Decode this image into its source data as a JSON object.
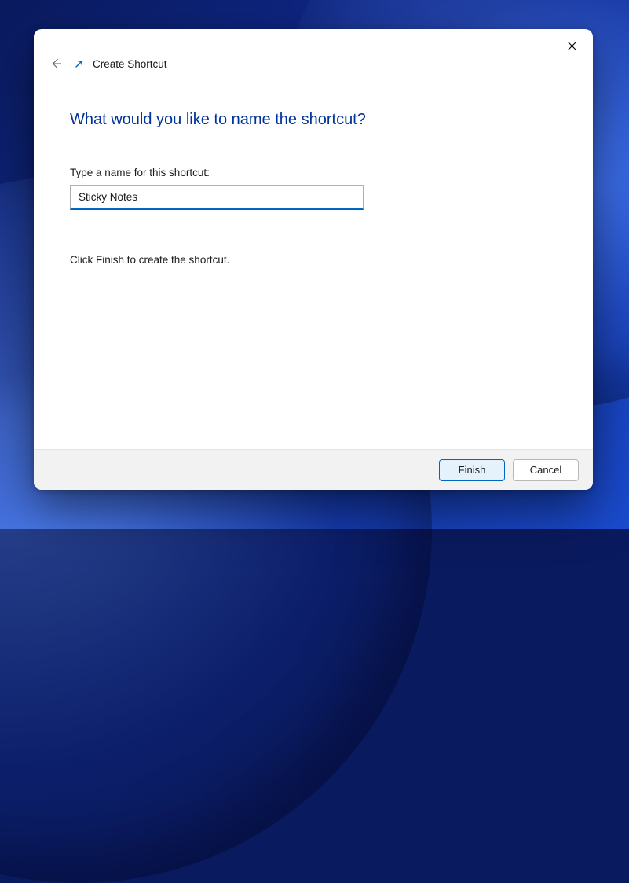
{
  "wizard": {
    "title": "Create Shortcut",
    "heading": "What would you like to name the shortcut?",
    "field_label": "Type a name for this shortcut:",
    "input_value": "Sticky Notes",
    "hint": "Click Finish to create the shortcut."
  },
  "buttons": {
    "finish": "Finish",
    "cancel": "Cancel"
  }
}
